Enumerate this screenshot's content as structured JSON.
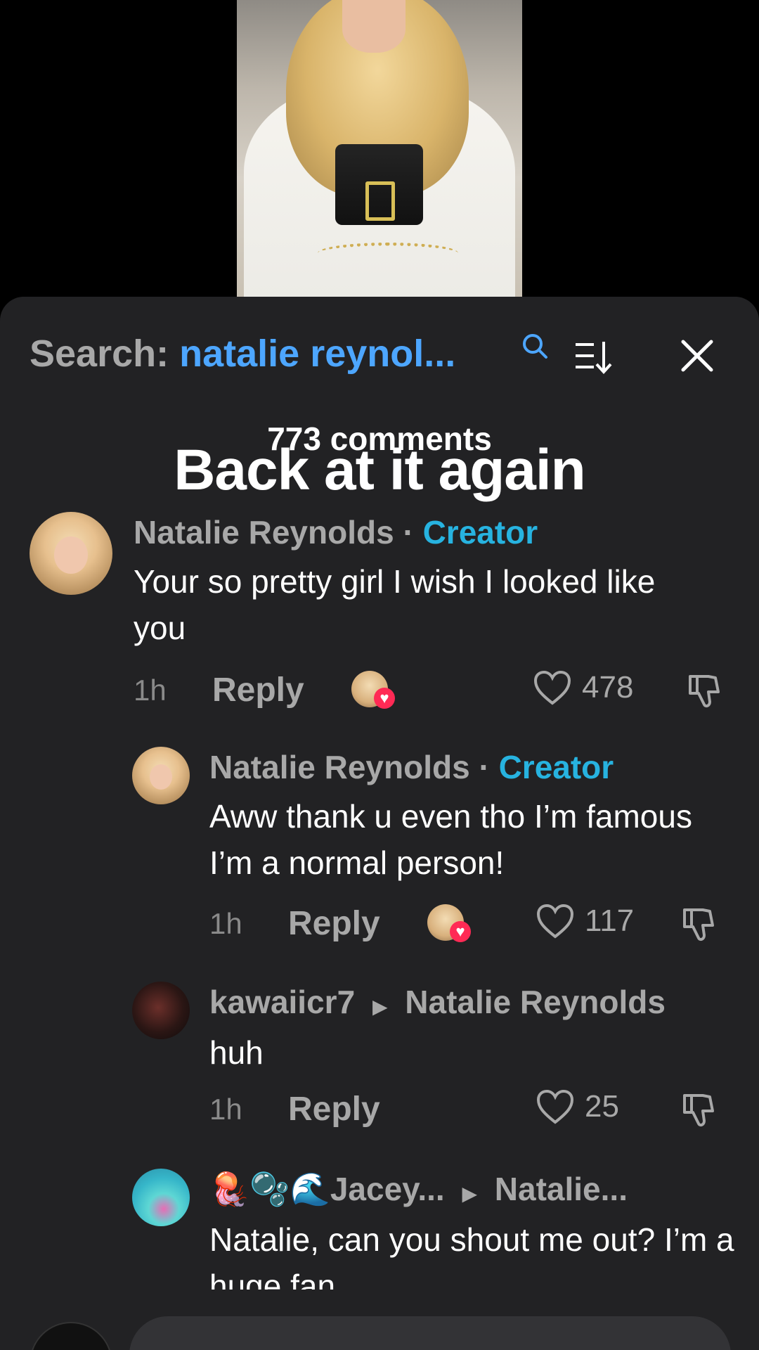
{
  "header": {
    "search_prefix": "Search:",
    "search_query": "natalie reynol...",
    "icons": [
      "search-icon",
      "sort-icon",
      "close-icon"
    ]
  },
  "comments_count": "773 comments",
  "overlay_caption": "Back at it again",
  "comments": [
    {
      "author": "Natalie Reynolds",
      "separator": "·",
      "tag": "Creator",
      "text": "Your so pretty girl I wish I looked like you",
      "time": "1h",
      "reply": "Reply",
      "likes": "478"
    },
    {
      "author": "Natalie Reynolds",
      "separator": "·",
      "tag": "Creator",
      "text": "Aww thank u even tho I’m famous I’m a normal person!",
      "time": "1h",
      "reply": "Reply",
      "likes": "117"
    },
    {
      "author": "kawaiicr7",
      "reply_to": "Natalie Reynolds",
      "text": "huh",
      "time": "1h",
      "reply": "Reply",
      "likes": "25"
    },
    {
      "author": "🪼🫧🌊Jacey...",
      "reply_to": "Natalie...",
      "text": "Natalie, can you shout me out? I’m a huge fan."
    }
  ],
  "colors": {
    "sheet_bg": "#222224",
    "accent_blue": "#4da6ff",
    "creator_blue": "#27b3e0",
    "muted": "#a8a8a8",
    "heart_red": "#ff2a55"
  }
}
